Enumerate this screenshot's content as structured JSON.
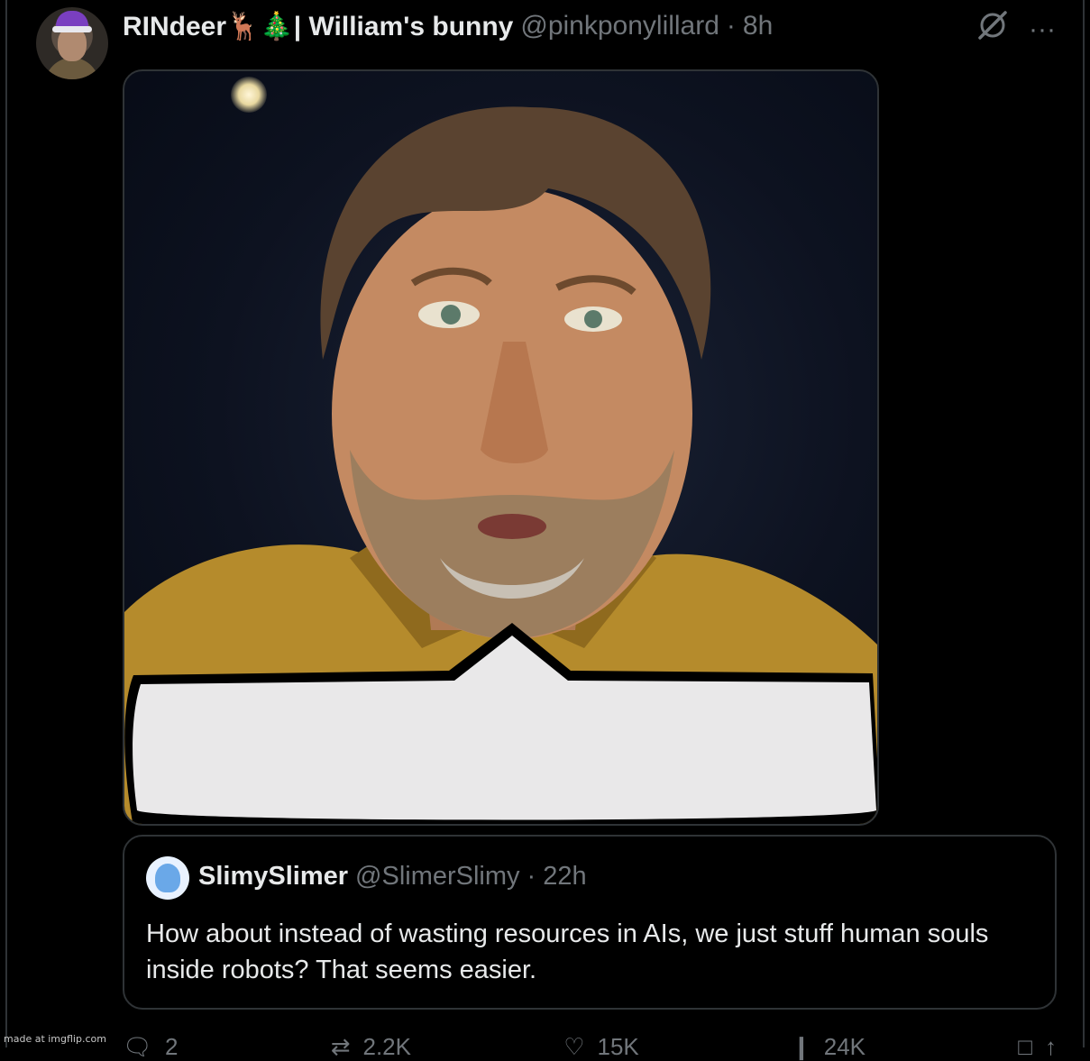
{
  "post": {
    "display_name": "RINdeer🦌🎄| William's bunny",
    "handle": "@pinkponylillard",
    "separator": "·",
    "time": "8h"
  },
  "header_icons": {
    "grok": "grok-icon",
    "more": "···"
  },
  "quoted_post": {
    "display_name": "SlimySlimer",
    "handle": "@SlimerSlimy",
    "separator": "·",
    "time": "22h",
    "text": "How about instead of wasting resources in AIs, we just stuff human souls inside robots? That seems easier."
  },
  "actions": {
    "reply": "2",
    "repost": "2.2K",
    "like": "15K",
    "views": "24K"
  },
  "watermark": "made at imgflip.com",
  "colors": {
    "background": "#000000",
    "text": "#e7e9ea",
    "muted": "#71767b",
    "border": "#2f3336",
    "speech_bubble": "#e9e8e9"
  }
}
